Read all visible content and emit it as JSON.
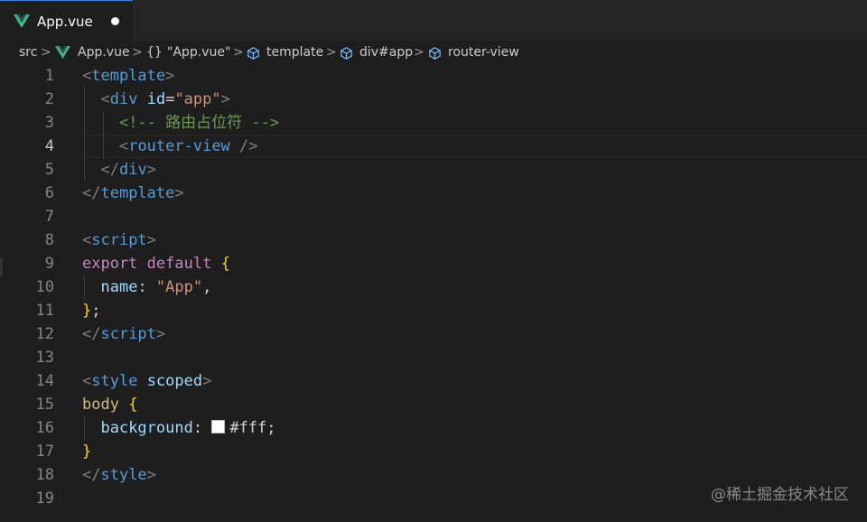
{
  "tab": {
    "label": "App.vue",
    "dirty": true
  },
  "breadcrumb": {
    "items": [
      {
        "label": "src",
        "icon": ""
      },
      {
        "label": "App.vue",
        "icon": "vue-icon"
      },
      {
        "label": "\"App.vue\"",
        "icon": "braces-icon"
      },
      {
        "label": "template",
        "icon": "cube-icon"
      },
      {
        "label": "div#app",
        "icon": "cube-icon"
      },
      {
        "label": "router-view",
        "icon": "cube-icon"
      }
    ],
    "separator": ">"
  },
  "editor": {
    "active_line": 4,
    "lines": [
      {
        "n": "1",
        "tokens": [
          [
            "t-punct",
            "<"
          ],
          [
            "t-tag",
            "template"
          ],
          [
            "t-punct",
            ">"
          ]
        ]
      },
      {
        "n": "2",
        "tokens": [
          [
            "t-text",
            "  "
          ],
          [
            "t-punct",
            "<"
          ],
          [
            "t-tag",
            "div"
          ],
          [
            "t-text",
            " "
          ],
          [
            "t-attr",
            "id"
          ],
          [
            "t-text",
            "="
          ],
          [
            "t-str",
            "\"app\""
          ],
          [
            "t-punct",
            ">"
          ]
        ]
      },
      {
        "n": "3",
        "tokens": [
          [
            "t-text",
            "    "
          ],
          [
            "t-comment",
            "<!-- 路由占位符 -->"
          ]
        ]
      },
      {
        "n": "4",
        "tokens": [
          [
            "t-text",
            "    "
          ],
          [
            "t-punct",
            "<"
          ],
          [
            "t-tag",
            "router-view"
          ],
          [
            "t-text",
            " "
          ],
          [
            "t-punct",
            "/>"
          ]
        ]
      },
      {
        "n": "5",
        "tokens": [
          [
            "t-text",
            "  "
          ],
          [
            "t-punct",
            "</"
          ],
          [
            "t-tag",
            "div"
          ],
          [
            "t-punct",
            ">"
          ]
        ]
      },
      {
        "n": "6",
        "tokens": [
          [
            "t-punct",
            "</"
          ],
          [
            "t-tag",
            "template"
          ],
          [
            "t-punct",
            ">"
          ]
        ]
      },
      {
        "n": "7",
        "tokens": []
      },
      {
        "n": "8",
        "tokens": [
          [
            "t-punct",
            "<"
          ],
          [
            "t-tag",
            "script"
          ],
          [
            "t-punct",
            ">"
          ]
        ]
      },
      {
        "n": "9",
        "tokens": [
          [
            "t-keyword",
            "export"
          ],
          [
            "t-text",
            " "
          ],
          [
            "t-keyword",
            "default"
          ],
          [
            "t-text",
            " "
          ],
          [
            "t-brace",
            "{"
          ]
        ]
      },
      {
        "n": "10",
        "tokens": [
          [
            "t-text",
            "  "
          ],
          [
            "t-attr",
            "name"
          ],
          [
            "t-text",
            ": "
          ],
          [
            "t-str",
            "\"App\""
          ],
          [
            "t-text",
            ","
          ]
        ]
      },
      {
        "n": "11",
        "tokens": [
          [
            "t-brace",
            "}"
          ],
          [
            "t-text",
            ";"
          ]
        ]
      },
      {
        "n": "12",
        "tokens": [
          [
            "t-punct",
            "</"
          ],
          [
            "t-tag",
            "script"
          ],
          [
            "t-punct",
            ">"
          ]
        ]
      },
      {
        "n": "13",
        "tokens": []
      },
      {
        "n": "14",
        "tokens": [
          [
            "t-punct",
            "<"
          ],
          [
            "t-tag",
            "style"
          ],
          [
            "t-text",
            " "
          ],
          [
            "t-attr",
            "scoped"
          ],
          [
            "t-punct",
            ">"
          ]
        ]
      },
      {
        "n": "15",
        "tokens": [
          [
            "t-sel",
            "body"
          ],
          [
            "t-text",
            " "
          ],
          [
            "t-brace",
            "{"
          ]
        ]
      },
      {
        "n": "16",
        "tokens": [
          [
            "t-text",
            "  "
          ],
          [
            "t-attr",
            "background"
          ],
          [
            "t-text",
            ": "
          ],
          [
            "swatch",
            ""
          ],
          [
            "t-text",
            "#fff;"
          ]
        ]
      },
      {
        "n": "17",
        "tokens": [
          [
            "t-brace",
            "}"
          ]
        ]
      },
      {
        "n": "18",
        "tokens": [
          [
            "t-punct",
            "</"
          ],
          [
            "t-tag",
            "style"
          ],
          [
            "t-punct",
            ">"
          ]
        ]
      },
      {
        "n": "19",
        "tokens": []
      }
    ]
  },
  "watermark": "@稀土掘金技术社区",
  "colors": {
    "background": "#1e1e1e",
    "vue_green": "#41b883",
    "tab_accent": "#2f80ed"
  }
}
